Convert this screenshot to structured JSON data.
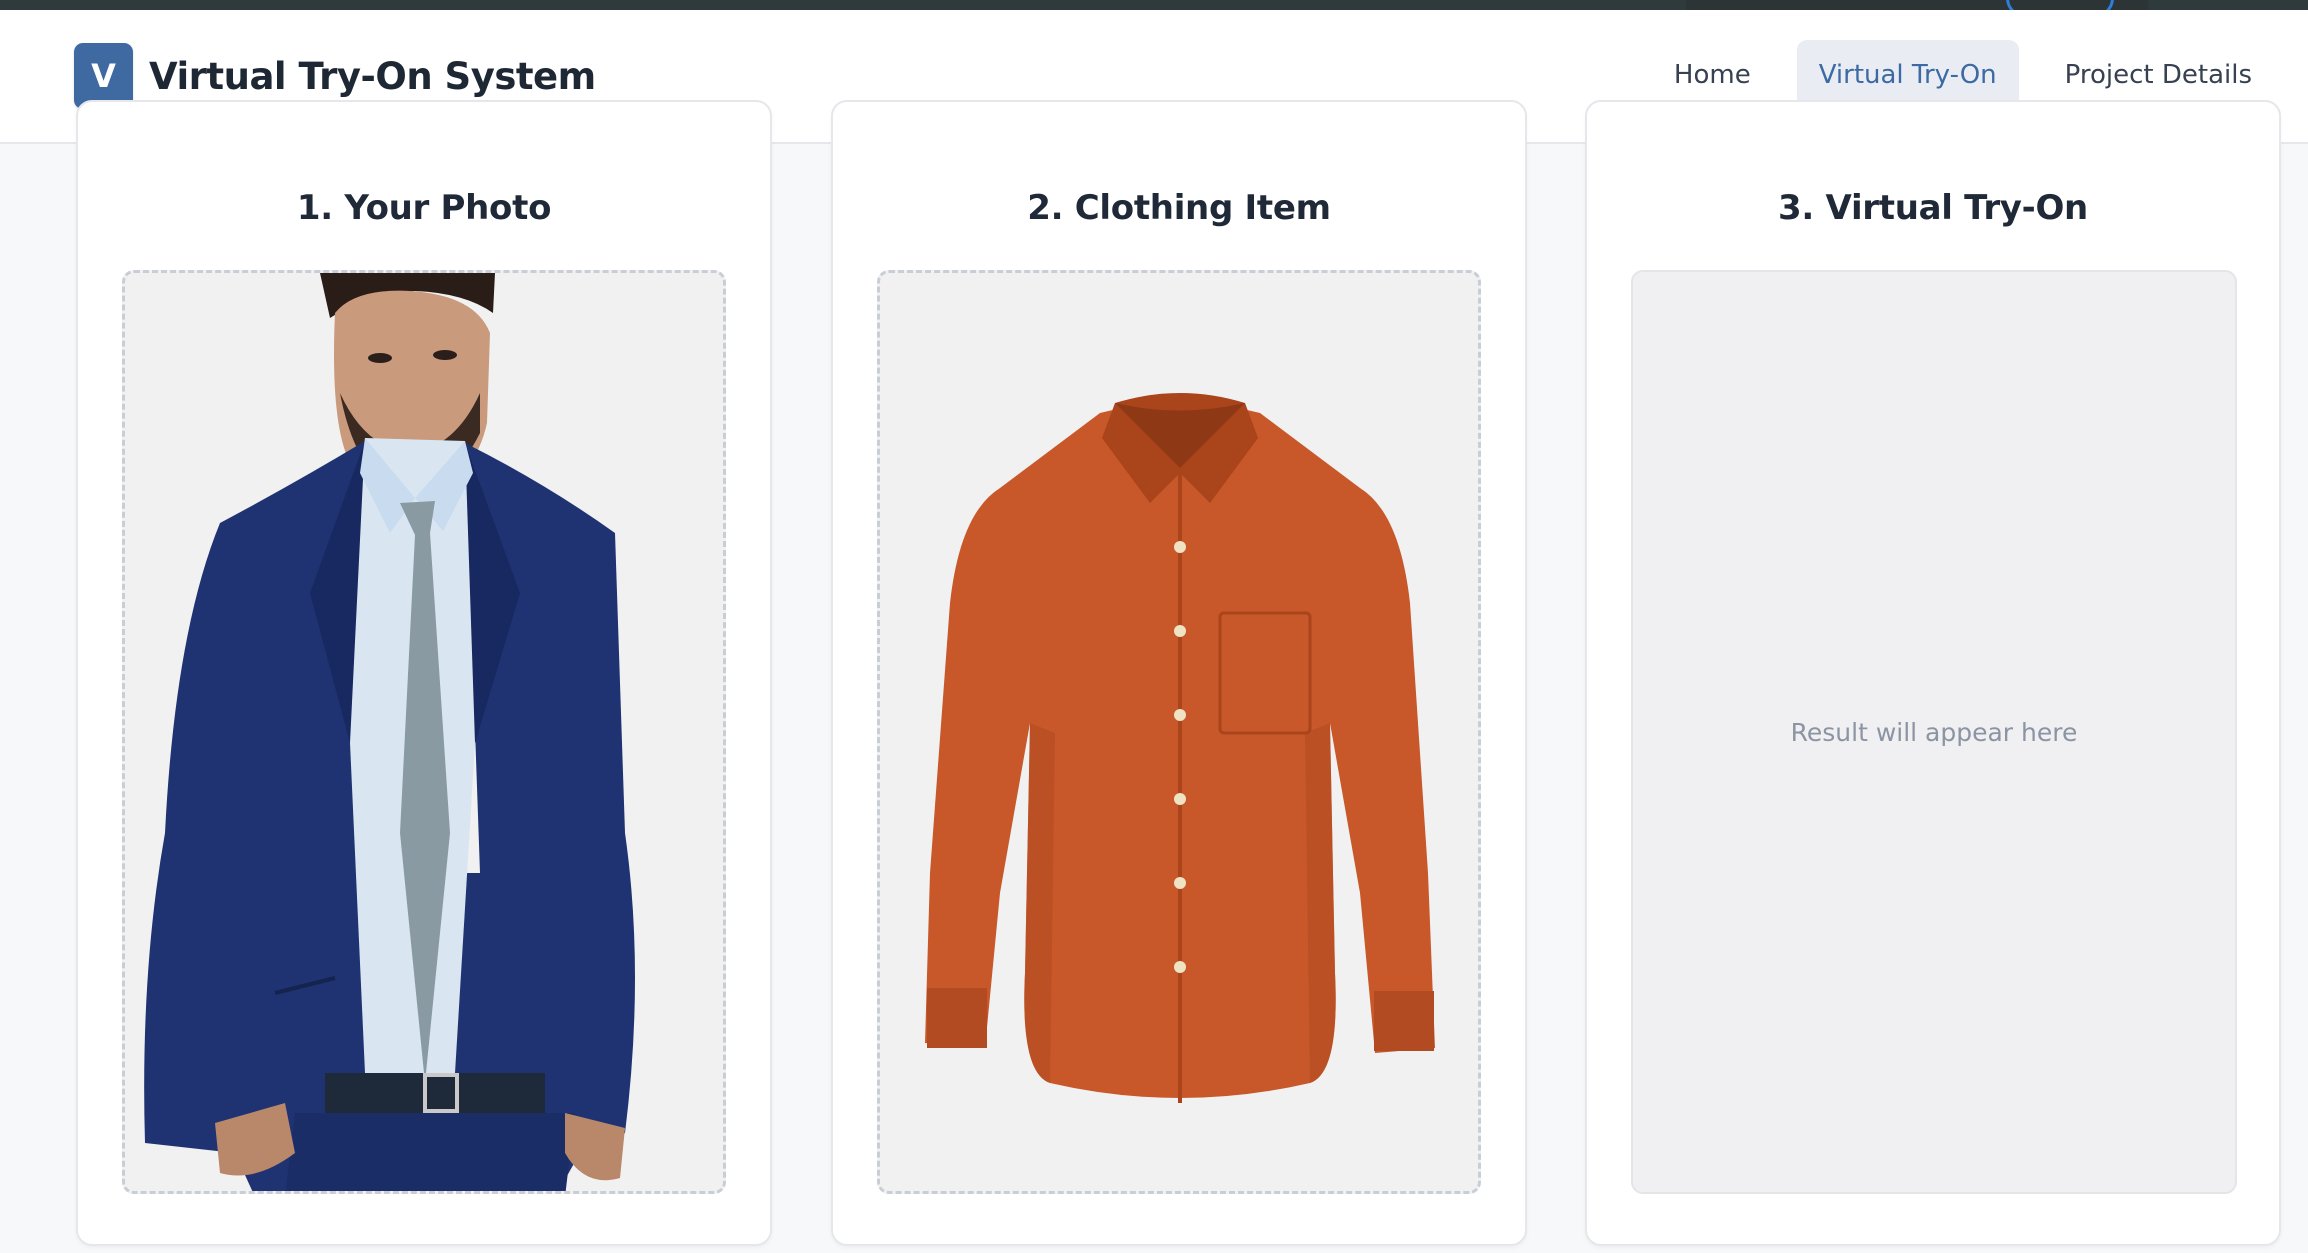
{
  "app": {
    "logo_letter": "V",
    "title": "Virtual Try-On System"
  },
  "nav": {
    "items": [
      {
        "label": "Home",
        "active": false
      },
      {
        "label": "Virtual Try-On",
        "active": true
      },
      {
        "label": "Project Details",
        "active": false
      }
    ]
  },
  "panels": {
    "photo": {
      "title": "1. Your Photo"
    },
    "clothing": {
      "title": "2. Clothing Item"
    },
    "result": {
      "title": "3. Virtual Try-On",
      "placeholder": "Result will appear here"
    }
  },
  "colors": {
    "accent": "#3f6aa1",
    "suit": "#1f3272",
    "shirt": "#c8582a",
    "tie": "#8a9aa2"
  }
}
